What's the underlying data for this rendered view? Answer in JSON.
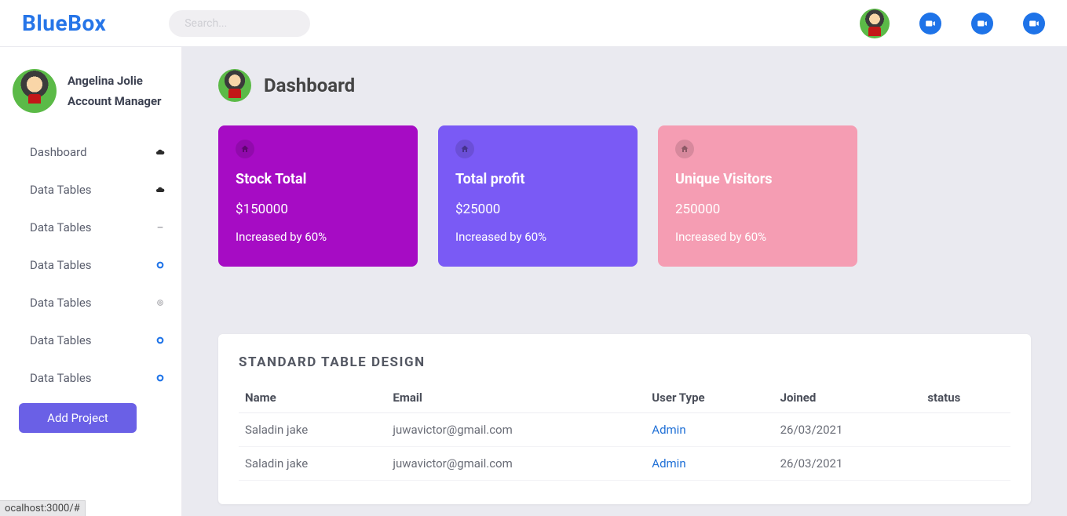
{
  "brand": "BlueBox",
  "search": {
    "placeholder": "Search..."
  },
  "user": {
    "name": "Angelina Jolie",
    "role": "Account Manager"
  },
  "nav": [
    {
      "label": "Dashboard",
      "icon": "cloud-dark"
    },
    {
      "label": "Data Tables",
      "icon": "cloud-dark"
    },
    {
      "label": "Data Tables",
      "icon": "dash-grey"
    },
    {
      "label": "Data Tables",
      "icon": "circle-blue"
    },
    {
      "label": "Data Tables",
      "icon": "target-grey"
    },
    {
      "label": "Data Tables",
      "icon": "circle-blue"
    },
    {
      "label": "Data Tables",
      "icon": "circle-blue"
    }
  ],
  "add_project": "Add Project",
  "page_title": "Dashboard",
  "cards": [
    {
      "title": "Stock Total",
      "value": "$150000",
      "sub": "Increased by 60%"
    },
    {
      "title": "Total profit",
      "value": "$25000",
      "sub": "Increased by 60%"
    },
    {
      "title": "Unique Visitors",
      "value": "250000",
      "sub": "Increased by 60%"
    }
  ],
  "table": {
    "title": "STANDARD TABLE DESIGN",
    "cols": [
      "Name",
      "Email",
      "User Type",
      "Joined",
      "status"
    ],
    "rows": [
      {
        "name": "Saladin jake",
        "email": "juwavictor@gmail.com",
        "type": "Admin",
        "joined": "26/03/2021",
        "status": ""
      },
      {
        "name": "Saladin jake",
        "email": "juwavictor@gmail.com",
        "type": "Admin",
        "joined": "26/03/2021",
        "status": ""
      }
    ]
  },
  "statusbar": "ocalhost:3000/#"
}
